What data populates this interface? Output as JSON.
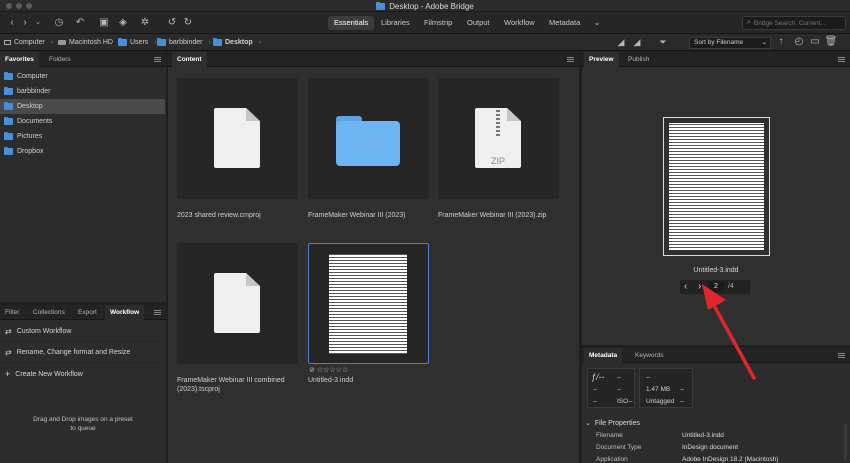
{
  "window": {
    "title": "Desktop - Adobe Bridge"
  },
  "workspaces": [
    "Essentials",
    "Libraries",
    "Filmstrip",
    "Output",
    "Workflow",
    "Metadata"
  ],
  "search": {
    "placeholder": "Bridge Search: Current..."
  },
  "breadcrumb": [
    "Computer",
    "Macintosh HD",
    "Users",
    "barbbinder",
    "Desktop"
  ],
  "sort": {
    "label": "Sort by Filename"
  },
  "favorites": {
    "tabs": [
      "Favorites",
      "Folders"
    ],
    "items": [
      "Computer",
      "barbbinder",
      "Desktop",
      "Documents",
      "Pictures",
      "Dropbox"
    ],
    "selected_index": 2
  },
  "workflow_panel": {
    "tabs": [
      "Filter",
      "Collections",
      "Export",
      "Workflow"
    ],
    "items": [
      "Custom Workflow",
      "Rename, Change format and Resize",
      "Create New Workflow"
    ],
    "drop_hint": "Drag and Drop images on a preset to queue"
  },
  "content": {
    "tab": "Content",
    "items": [
      {
        "name": "2023 shared review.cmproj",
        "kind": "generic-file"
      },
      {
        "name": "FrameMaker Webinar III (2023)",
        "kind": "folder"
      },
      {
        "name": "FrameMaker Webinar III (2023).zip",
        "kind": "zip",
        "badge": "ZIP"
      },
      {
        "name": "FrameMaker Webinar III combined (2023).tscproj",
        "kind": "generic-file"
      },
      {
        "name": "Untitled-3.indd",
        "kind": "document",
        "selected": true,
        "rating": "☆☆☆☆☆",
        "reject_glyph": "⊘"
      }
    ]
  },
  "preview": {
    "tabs": [
      "Preview",
      "Publish"
    ],
    "filename": "Untitled-3.indd",
    "page_current": "2",
    "page_total": "/4"
  },
  "metadata": {
    "tabs": [
      "Metadata",
      "Keywords"
    ],
    "quick": {
      "fstop": "ƒ/--",
      "shutter": "--",
      "row2_a": "--",
      "row2_b": "--",
      "row3_a": "--",
      "iso": "ISO--",
      "size": "1.47 MB",
      "size_extra": "--",
      "colorspace": "Untagged",
      "colorspace_extra": "--",
      "top_right": "--"
    },
    "section": "File Properties",
    "properties": [
      {
        "label": "Filename",
        "value": "Untitled-3.indd"
      },
      {
        "label": "Document Type",
        "value": "InDesign document"
      },
      {
        "label": "Application",
        "value": "Adobe InDesign 18.2 (Macintosh)"
      }
    ]
  },
  "colors": {
    "accent_blue": "#4f7bd1",
    "folder_blue": "#4a90d9",
    "annotation_red": "#e0262b"
  },
  "annotation": {
    "type": "red-arrow",
    "points_to": "next-page-button"
  }
}
